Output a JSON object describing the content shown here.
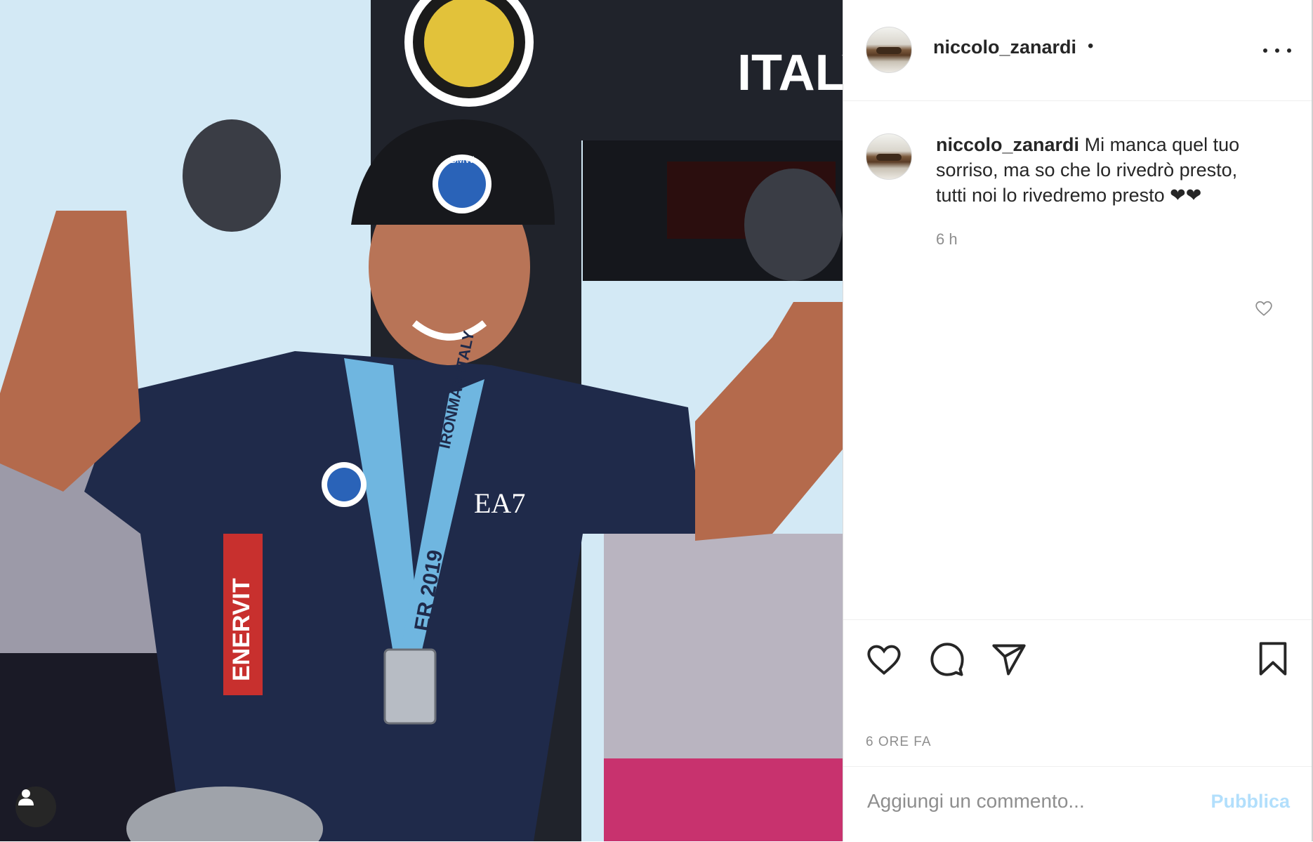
{
  "post": {
    "username": "niccolo_zanardi",
    "header_separator": "•",
    "caption": {
      "username": "niccolo_zanardi",
      "text": "Mi manca quel tuo sorriso, ma so che lo rivedrò presto, tutti noi lo rivedremo presto ❤❤"
    },
    "caption_time": "6 h",
    "timestamp": "6 ORE FA"
  },
  "photo": {
    "sign_text": "ITALY",
    "jersey_brand": "ENERVIT",
    "jersey_sponsor": "EA7",
    "medal_ribbon": "IRONMAN ITALY",
    "medal_year": "ER 2019",
    "helmet_logo": "BMW"
  },
  "icons": {
    "more": "more-options-icon",
    "like": "heart-icon",
    "comment": "comment-bubble-icon",
    "share": "paper-plane-icon",
    "save": "bookmark-icon",
    "user_tag": "person-icon"
  },
  "add_comment": {
    "placeholder": "Aggiungi un commento...",
    "publish_label": "Pubblica"
  },
  "colors": {
    "text": "#262626",
    "secondary": "#8e8e8e",
    "publish_disabled": "#b2dffc",
    "border": "#efefef"
  }
}
